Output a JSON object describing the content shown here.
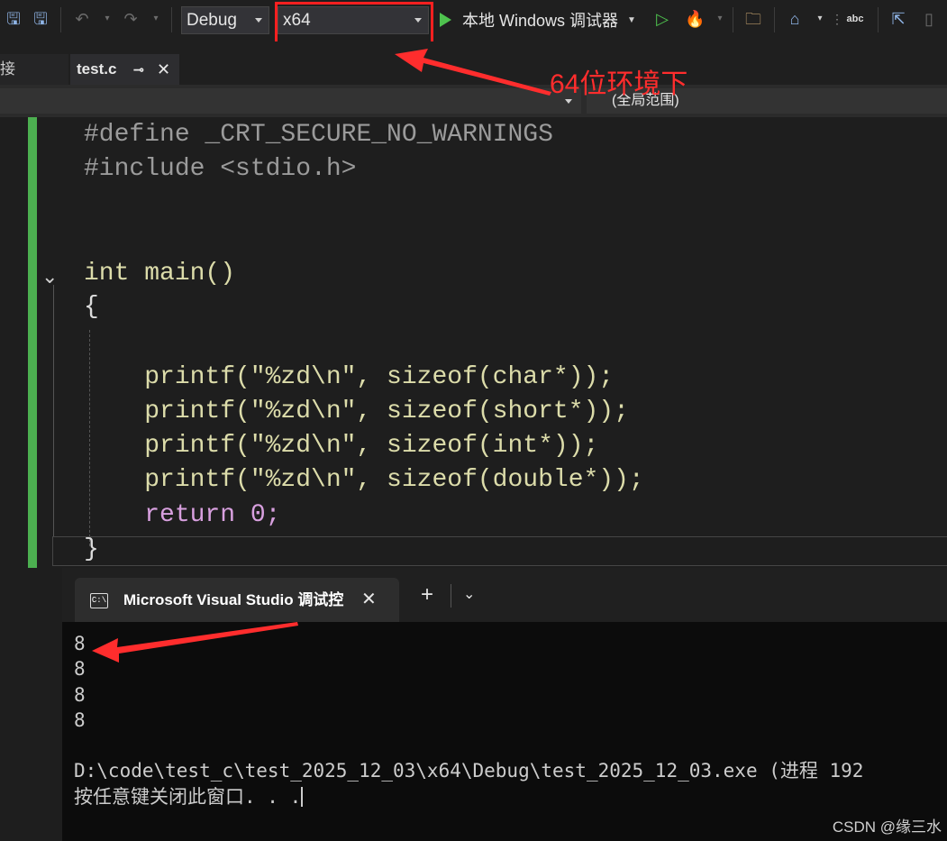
{
  "toolbar": {
    "config_value": "Debug",
    "platform_value": "x64",
    "run_label": "本地 Windows 调试器"
  },
  "tabs": {
    "left_tab": "接",
    "active_tab": "test.c",
    "pin": "⊸",
    "close": "✕"
  },
  "navbar": {
    "scope": "(全局范围)"
  },
  "annotation": {
    "text": "64位环境下",
    "color": "#ff2d2d"
  },
  "editor": {
    "lines": [
      "#define _CRT_SECURE_NO_WARNINGS",
      "#include <stdio.h>",
      "",
      "int main()",
      "{",
      "",
      "    printf(\"%zd\\n\", sizeof(char*));",
      "    printf(\"%zd\\n\", sizeof(short*));",
      "    printf(\"%zd\\n\", sizeof(int*));",
      "    printf(\"%zd\\n\", sizeof(double*));",
      "    return 0;",
      "}"
    ]
  },
  "terminal": {
    "tab_title": "Microsoft Visual Studio 调试控",
    "output": [
      "8",
      "8",
      "8",
      "8",
      "",
      "D:\\code\\test_c\\test_2025_12_03\\x64\\Debug\\test_2025_12_03.exe (进程 192",
      "按任意键关闭此窗口. . ."
    ]
  },
  "watermark": "CSDN @缘三水",
  "colors": {
    "accent_red": "#ff2020",
    "change_bar": "#4caf50",
    "run_green": "#4ec24e"
  }
}
